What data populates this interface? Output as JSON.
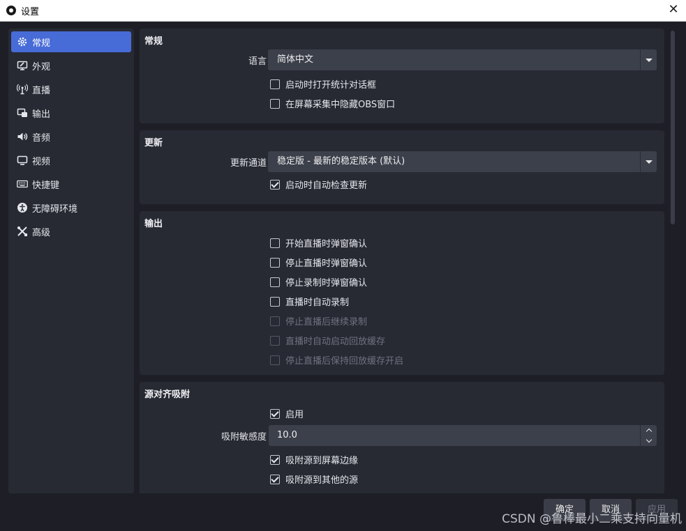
{
  "window": {
    "title": "设置",
    "close_glyph": "✕"
  },
  "sidebar": {
    "items": [
      {
        "label": "常规",
        "icon": "gear-icon"
      },
      {
        "label": "外观",
        "icon": "appearance-icon"
      },
      {
        "label": "直播",
        "icon": "broadcast-icon"
      },
      {
        "label": "输出",
        "icon": "output-icon"
      },
      {
        "label": "音频",
        "icon": "speaker-icon"
      },
      {
        "label": "视频",
        "icon": "monitor-icon"
      },
      {
        "label": "快捷键",
        "icon": "keyboard-icon"
      },
      {
        "label": "无障碍环境",
        "icon": "accessibility-icon"
      },
      {
        "label": "高级",
        "icon": "tools-icon"
      }
    ],
    "active_index": 0
  },
  "general": {
    "title": "常规",
    "language_label": "语言",
    "language_value": "简体中文",
    "open_stats_on_start": "启动时打开统计对话框",
    "hide_obs_in_capture": "在屏幕采集中隐藏OBS窗口"
  },
  "update": {
    "title": "更新",
    "channel_label": "更新通道",
    "channel_value": "稳定版 - 最新的稳定版本 (默认)",
    "auto_check": "启动时自动检查更新"
  },
  "output": {
    "title": "输出",
    "items": [
      {
        "label": "开始直播时弹窗确认",
        "checked": false,
        "disabled": false
      },
      {
        "label": "停止直播时弹窗确认",
        "checked": false,
        "disabled": false
      },
      {
        "label": "停止录制时弹窗确认",
        "checked": false,
        "disabled": false
      },
      {
        "label": "直播时自动录制",
        "checked": false,
        "disabled": false
      },
      {
        "label": "停止直播后继续录制",
        "checked": false,
        "disabled": true
      },
      {
        "label": "直播时自动启动回放缓存",
        "checked": false,
        "disabled": true
      },
      {
        "label": "停止直播后保持回放缓存开启",
        "checked": false,
        "disabled": true
      }
    ]
  },
  "snapping": {
    "title": "源对齐吸附",
    "enable": "启用",
    "sensitivity_label": "吸附敏感度",
    "sensitivity_value": "10.0",
    "snap_to_edges": "吸附源到屏幕边缘",
    "snap_to_sources": "吸附源到其他的源"
  },
  "footer": {
    "ok": "确定",
    "cancel": "取消",
    "apply": "应用"
  },
  "watermark": "CSDN @鲁棒最小二乘支持向量机",
  "colors": {
    "accent": "#476bd7",
    "background": "#1e1f26",
    "panel": "#272a33"
  }
}
